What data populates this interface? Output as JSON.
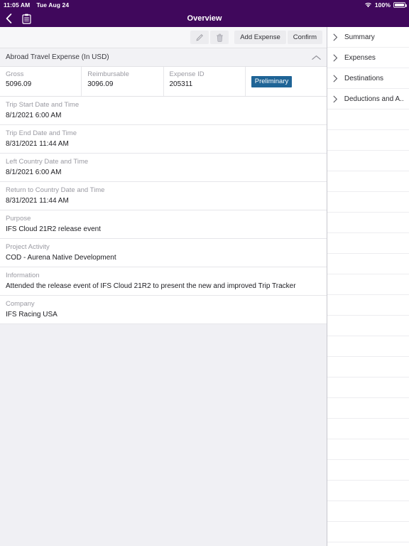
{
  "statusbar": {
    "time": "11:05 AM",
    "date": "Tue Aug 24",
    "battery_pct": "100%",
    "wifi_icon": "wifi-icon",
    "battery_icon": "battery-full-icon"
  },
  "navbar": {
    "title": "Overview",
    "back_icon": "chevron-left-icon",
    "clipboard_icon": "clipboard-list-icon"
  },
  "toolbar": {
    "edit_icon": "pencil-icon",
    "delete_icon": "trash-icon",
    "add_expense_label": "Add Expense",
    "confirm_label": "Confirm"
  },
  "card": {
    "title": "Abroad Travel Expense (In USD)",
    "collapse_icon": "chevron-up-icon",
    "summary": [
      {
        "label": "Gross",
        "value": "5096.09"
      },
      {
        "label": "Reimbursable",
        "value": "3096.09"
      },
      {
        "label": "Expense ID",
        "value": "205311"
      }
    ],
    "status_badge": {
      "label": "Preliminary",
      "background": "#1f6496",
      "color": "#ffffff"
    },
    "fields": [
      {
        "label": "Trip Start Date and Time",
        "value": "8/1/2021 6:00 AM"
      },
      {
        "label": "Trip End Date and Time",
        "value": "8/31/2021 11:44 AM"
      },
      {
        "label": "Left Country Date and Time",
        "value": "8/1/2021 6:00 AM"
      },
      {
        "label": "Return to Country Date and Time",
        "value": "8/31/2021 11:44 AM"
      },
      {
        "label": "Purpose",
        "value": "IFS Cloud 21R2 release event"
      },
      {
        "label": "Project Activity",
        "value": "COD - Aurena Native Development"
      },
      {
        "label": "Information",
        "value": "Attended the release event of IFS Cloud 21R2 to present the new and improved Trip Tracker"
      },
      {
        "label": "Company",
        "value": "IFS Racing USA"
      }
    ]
  },
  "sidebar": {
    "items": [
      {
        "label": "Summary",
        "icon": "chevron-right-icon"
      },
      {
        "label": "Expenses",
        "icon": "chevron-right-icon"
      },
      {
        "label": "Destinations",
        "icon": "chevron-right-icon"
      },
      {
        "label": "Deductions and A...",
        "icon": "chevron-right-icon"
      }
    ],
    "empty_row_count": 21
  },
  "colors": {
    "header_purple": "#40085c",
    "page_background": "#f0f0f4",
    "badge_blue": "#1f6496"
  }
}
